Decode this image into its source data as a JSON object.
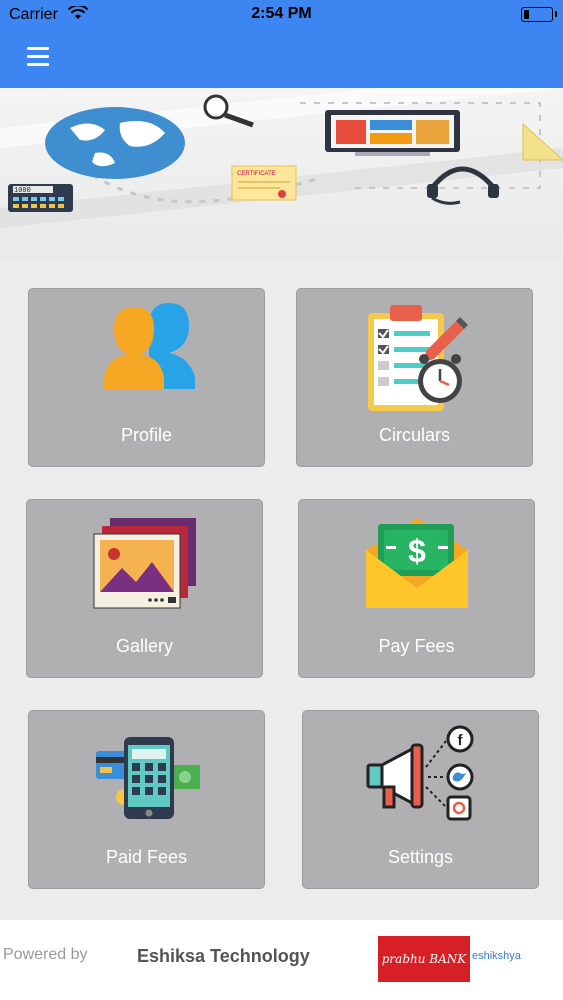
{
  "status_bar": {
    "carrier": "Carrier",
    "time": "2:54 PM"
  },
  "nav": {
    "menu_icon": "hamburger-icon"
  },
  "banner": {
    "certificate_text": "CERTIFICATE",
    "calculator_display": "1000"
  },
  "tiles": [
    {
      "label": "Profile",
      "icon": "profile-icon"
    },
    {
      "label": "Circulars",
      "icon": "clipboard-clock-icon"
    },
    {
      "label": "Gallery",
      "icon": "gallery-icon"
    },
    {
      "label": "Pay Fees",
      "icon": "money-envelope-icon"
    },
    {
      "label": "Paid Fees",
      "icon": "phone-card-icon"
    },
    {
      "label": "Settings",
      "icon": "megaphone-social-icon"
    }
  ],
  "footer": {
    "powered_by": "Powered by",
    "company": "Eshiksa Technology",
    "bank_logo_text": "prabhu BANK",
    "eshikshya_logo_text": "eshikshya"
  },
  "colors": {
    "accent": "#3d85f0",
    "tile": "#b0b0b2"
  }
}
